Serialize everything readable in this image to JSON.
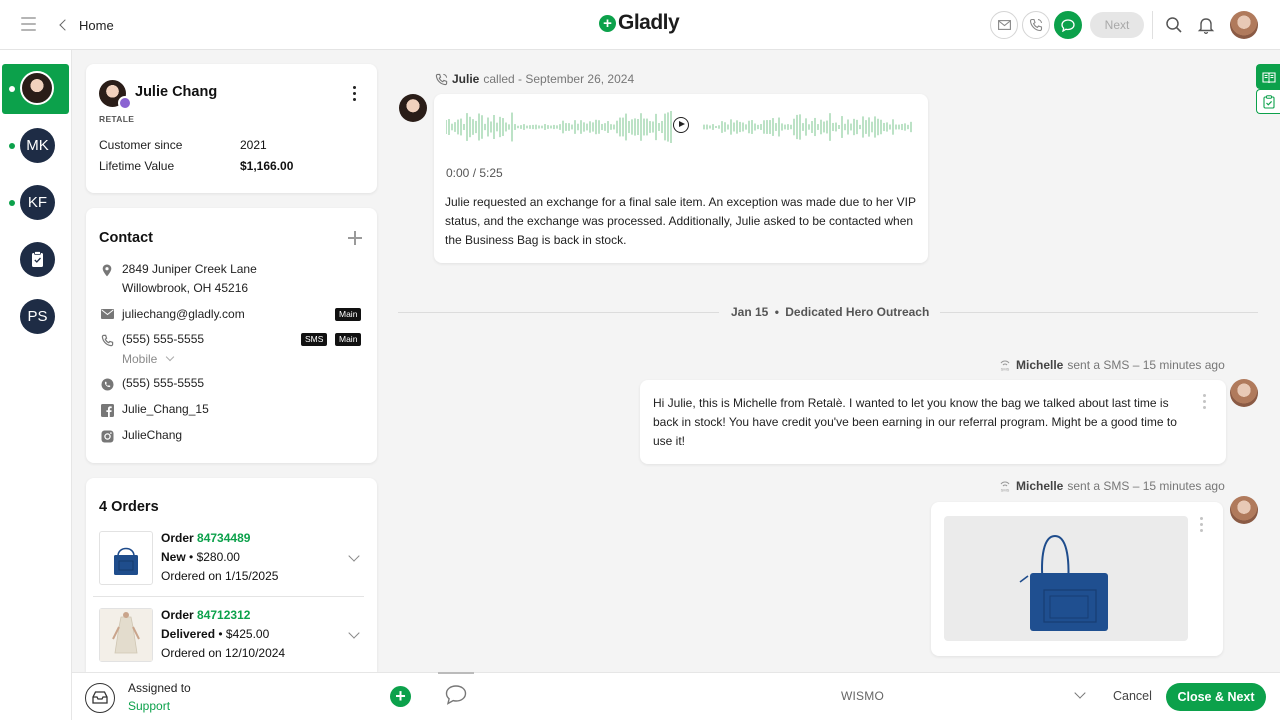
{
  "header": {
    "back_label": "Home",
    "logo_text": "Gladly",
    "next_label": "Next",
    "channel_icons": [
      "email-icon",
      "phone-icon",
      "chat-icon"
    ],
    "accent_color": "#0ca14b"
  },
  "rail": {
    "items": [
      {
        "initials": "MK"
      },
      {
        "initials": "KF"
      },
      {
        "initials": "PS"
      }
    ]
  },
  "customer": {
    "name": "Julie Chang",
    "tag": "RETALE",
    "customer_since_label": "Customer since",
    "customer_since_value": "2021",
    "lifetime_value_label": "Lifetime Value",
    "lifetime_value_value": "$1,166.00"
  },
  "contact": {
    "title": "Contact",
    "address_line1": "2849 Juniper Creek Lane",
    "address_line2": "Willowbrook, OH 45216",
    "email": "juliechang@gladly.com",
    "email_badge": "Main",
    "phone": "(555) 555-5555",
    "phone_badge_sms": "SMS",
    "phone_badge_main": "Main",
    "phone_type": "Mobile",
    "whatsapp": "(555) 555-5555",
    "facebook": "Julie_Chang_15",
    "instagram": "JulieChang"
  },
  "orders": {
    "title": "4 Orders",
    "items": [
      {
        "label": "Order",
        "number": "84734489",
        "status": "New",
        "price": "$280.00",
        "date_text": "Ordered on 1/15/2025"
      },
      {
        "label": "Order",
        "number": "84712312",
        "status": "Delivered",
        "price": "$425.00",
        "date_text": "Ordered on 12/10/2024"
      }
    ]
  },
  "conversation": {
    "call": {
      "name": "Julie",
      "action": "called - September 26, 2024",
      "time": "0:00 / 5:25",
      "summary": "Julie requested an exchange for a final sale item. An exception was made due to her VIP status, and the exchange was processed. Additionally, Julie asked to be contacted when the Business Bag is back in stock."
    },
    "divider": {
      "date": "Jan 15",
      "separator": "•",
      "label": "Dedicated Hero Outreach"
    },
    "sms1": {
      "name": "Michelle",
      "action": "sent a SMS – 15 minutes ago",
      "text": "Hi Julie, this is Michelle from Retalè. I wanted to let you know the bag we talked about last time is back in stock!  You have credit you've been earning in our referral program. Might be a good time to use it!"
    },
    "sms2": {
      "name": "Michelle",
      "action": "sent a SMS – 15 minutes ago"
    }
  },
  "footer": {
    "assigned_label": "Assigned to",
    "assigned_team": "Support",
    "topic": "WISMO",
    "cancel_label": "Cancel",
    "close_next_label": "Close & Next"
  }
}
